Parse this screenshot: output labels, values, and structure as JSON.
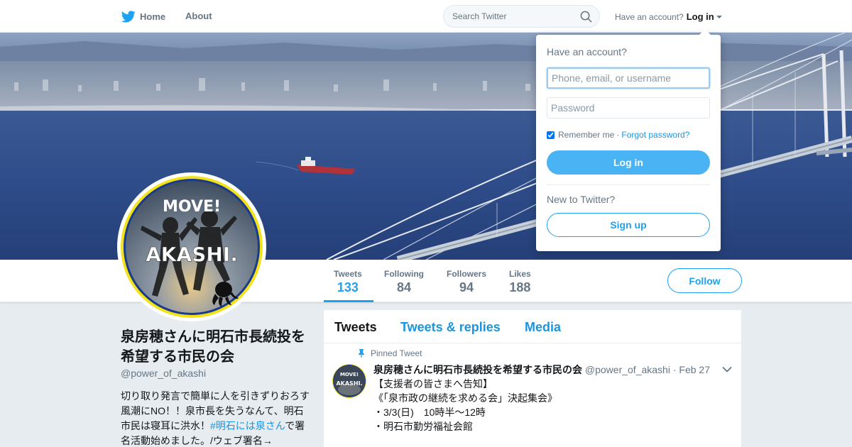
{
  "nav": {
    "home_label": "Home",
    "about_label": "About",
    "search_placeholder": "Search Twitter",
    "account_prompt": "Have an account?",
    "login_label": "Log in"
  },
  "banner": {
    "logo_line1": "MOVE!",
    "logo_line2": "AKASHI."
  },
  "stats": [
    {
      "label": "Tweets",
      "value": "133"
    },
    {
      "label": "Following",
      "value": "84"
    },
    {
      "label": "Followers",
      "value": "94"
    },
    {
      "label": "Likes",
      "value": "188"
    }
  ],
  "follow_label": "Follow",
  "profile": {
    "name": "泉房穂さんに明石市長続投を希望する市民の会",
    "handle": "@power_of_akashi",
    "bio_text": "切り取り発言で簡単に人を引きずりおろす風潮にNO！！泉市長を失うなんて、明石市民は寝耳に洪水！",
    "bio_hashtag": "#明石には泉さん",
    "bio_tail": "で署名活動始めました。/ウェブ署名→"
  },
  "timeline": {
    "tabs": [
      "Tweets",
      "Tweets & replies",
      "Media"
    ],
    "pinned_label": "Pinned Tweet",
    "tweet": {
      "name": "泉房穂さんに明石市長続投を希望する市民の会",
      "handle": "@power_of_akashi",
      "separator": "·",
      "date": "Feb 27",
      "lines": [
        "【支援者の皆さまへ告知】",
        "《「泉市政の継続を求める会」決起集会》",
        "・3/3(日)　10時半～12時",
        "・明石市勤労福祉会館"
      ]
    }
  },
  "login_dropdown": {
    "title": "Have an account?",
    "username_placeholder": "Phone, email, or username",
    "password_placeholder": "Password",
    "remember_label": "Remember me",
    "separator": "·",
    "forgot_label": "Forgot password?",
    "login_button": "Log in",
    "new_prompt": "New to Twitter?",
    "signup_button": "Sign up"
  },
  "colors": {
    "accent": "#1da1f2",
    "link": "#1b95e0",
    "login_button": "#4ab3f4",
    "background": "#e6ecf0"
  },
  "icons": {
    "brand": "twitter-bird-icon",
    "search": "search-icon",
    "pin": "pin-icon",
    "dropdown": "chevron-down-icon"
  }
}
